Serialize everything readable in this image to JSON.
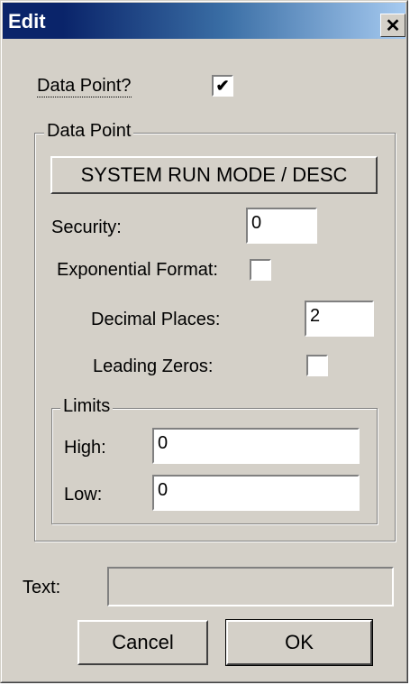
{
  "window": {
    "title": "Edit",
    "close_glyph": "✕"
  },
  "data_point_toggle": {
    "label": "Data Point?",
    "checked": true,
    "check_glyph": "✔"
  },
  "data_point_group": {
    "title": "Data Point",
    "mode_button_label": "SYSTEM RUN MODE / DESC",
    "security_label": "Security:",
    "security_value": "0",
    "exponential_label": "Exponential Format:",
    "exponential_checked": false,
    "decimal_places_label": "Decimal Places:",
    "decimal_places_value": "2",
    "leading_zeros_label": "Leading Zeros:",
    "leading_zeros_checked": false
  },
  "limits_group": {
    "title": "Limits",
    "high_label": "High:",
    "high_value": "0",
    "low_label": "Low:",
    "low_value": "0"
  },
  "text_field": {
    "label": "Text:",
    "value": ""
  },
  "buttons": {
    "cancel_label": "Cancel",
    "ok_label": "OK"
  },
  "colors": {
    "face": "#d4d0c8",
    "title_start": "#0a246a",
    "title_end": "#a6caf0"
  }
}
